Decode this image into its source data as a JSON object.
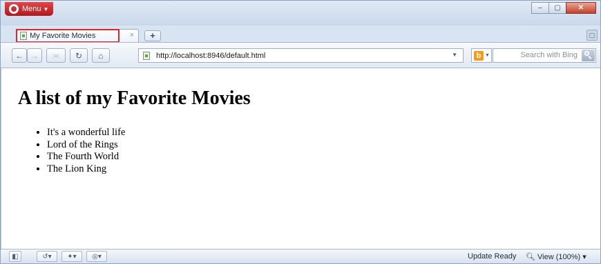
{
  "browser": {
    "menu_label": "Menu",
    "window_controls": {
      "minimize": "–",
      "maximize": "▢",
      "close": "✕"
    }
  },
  "tabs": [
    {
      "title": "My Favorite Movies",
      "close_glyph": "×"
    }
  ],
  "new_tab_glyph": "+",
  "toolbar": {
    "back_icon": "back-arrow-icon",
    "forward_icon": "forward-arrow-icon",
    "key_icon": "key-icon",
    "reload_icon": "reload-icon",
    "home_icon": "home-icon",
    "address": "http://localhost:8946/default.html",
    "search_placeholder": "Search with Bing",
    "search_engine": "Bing"
  },
  "page": {
    "heading": "A list of my Favorite Movies",
    "movies": [
      "It's a wonderful life",
      "Lord of the Rings",
      "The Fourth World",
      "The Lion King"
    ]
  },
  "statusbar": {
    "update_status": "Update Ready",
    "zoom": "View (100%)"
  }
}
